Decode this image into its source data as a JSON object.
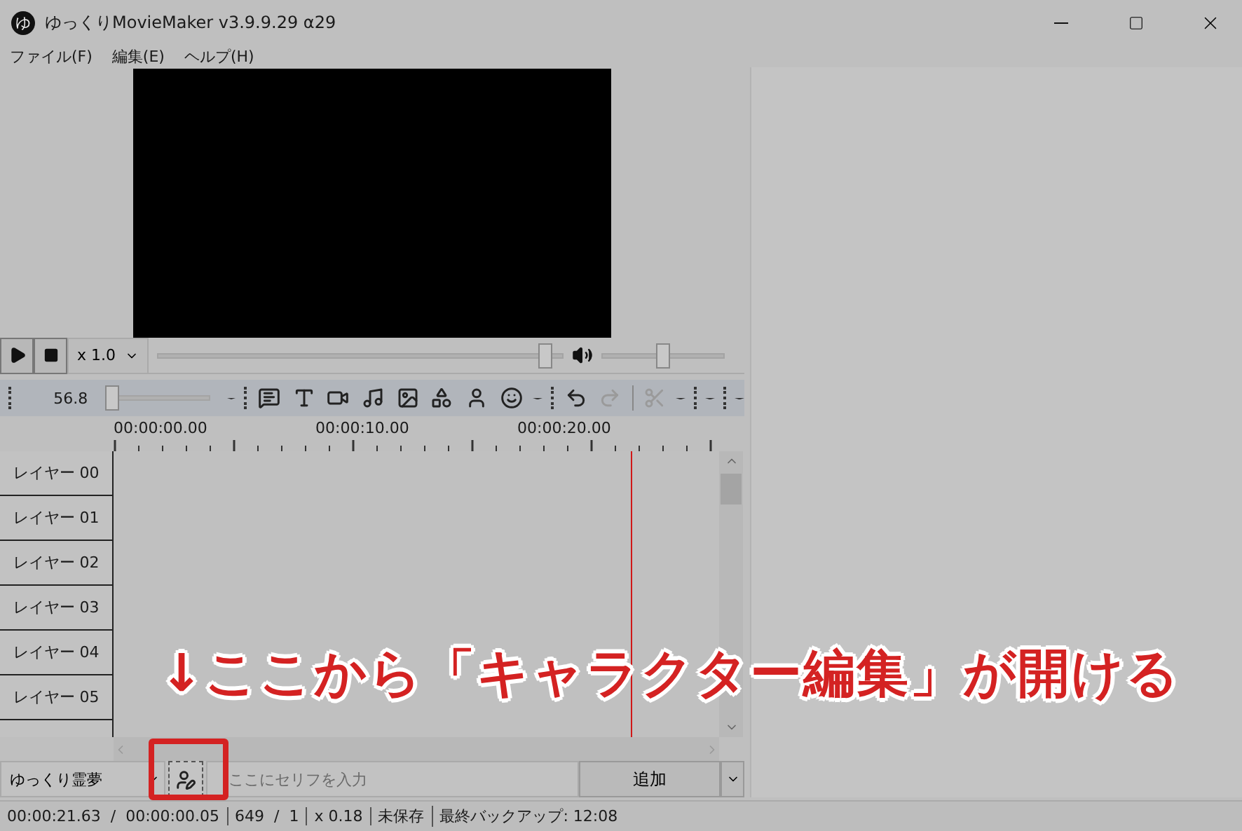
{
  "window": {
    "app_icon": "ゆ",
    "title": "ゆっくりMovieMaker v3.9.9.29 α29"
  },
  "menu": [
    "ファイル(F)",
    "編集(E)",
    "ヘルプ(H)"
  ],
  "player": {
    "speed": "x 1.0",
    "seek": {
      "level": 0.97
    },
    "volume": {
      "level": 0.5
    }
  },
  "toolbar": {
    "zoom": "56.8",
    "zoom_slider": {
      "level": 0.0
    },
    "tools": [
      {
        "kind": "speech",
        "disabled": false
      },
      {
        "kind": "text",
        "disabled": false
      },
      {
        "kind": "video",
        "disabled": false
      },
      {
        "kind": "music",
        "disabled": false
      },
      {
        "kind": "image",
        "disabled": false
      },
      {
        "kind": "shapes",
        "disabled": false
      },
      {
        "kind": "person",
        "disabled": false
      },
      {
        "kind": "smile",
        "disabled": false
      },
      {
        "kind": "undo",
        "disabled": false
      },
      {
        "kind": "redo",
        "disabled": true
      },
      {
        "kind": "cut",
        "disabled": true
      }
    ]
  },
  "timeline": {
    "ruler": [
      "00:00:00.00",
      "00:00:10.00",
      "00:00:20.00"
    ],
    "playhead": {
      "level": 0.854
    },
    "layers": [
      "レイヤー 00",
      "レイヤー 01",
      "レイヤー 02",
      "レイヤー 03",
      "レイヤー 04",
      "レイヤー 05"
    ]
  },
  "input_row": {
    "character": "ゆっくり霊夢",
    "placeholder": "ここにセリフを入力",
    "add_button": "追加"
  },
  "status_bar": [
    "00:00:21.63  /  00:00:00.05",
    "649  /  1",
    "x 0.18",
    "未保存",
    "最終バックアップ: 12:08"
  ],
  "annotation": {
    "text": "↓ここから「キャラクター編集」が開ける"
  }
}
